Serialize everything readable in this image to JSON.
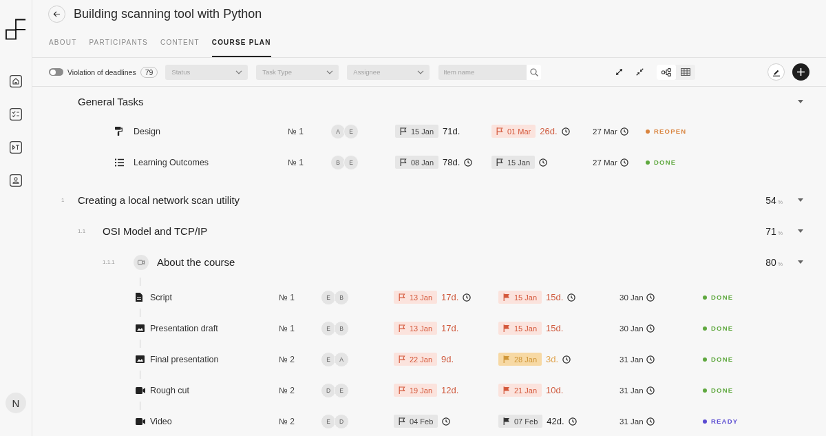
{
  "sidebar": {
    "user_initial": "N"
  },
  "header": {
    "title": "Building scanning tool with Python"
  },
  "tabs": [
    {
      "label": "ABOUT",
      "selected": false
    },
    {
      "label": "PARTICIPANTS",
      "selected": false
    },
    {
      "label": "CONTENT",
      "selected": false
    },
    {
      "label": "COURSE PLAN",
      "selected": true
    }
  ],
  "toolbar": {
    "deadline_filter": {
      "label": "Violation of deadlines",
      "on": false,
      "count": "79"
    },
    "filters": [
      {
        "placeholder": "Status"
      },
      {
        "placeholder": "Task Type"
      },
      {
        "placeholder": "Assignee"
      }
    ],
    "search": {
      "placeholder": "Item name"
    },
    "views": [
      {
        "kind": "tree",
        "selected": true
      },
      {
        "kind": "grid",
        "selected": false
      }
    ]
  },
  "plan": {
    "general": {
      "title": "General Tasks",
      "expanded": true,
      "tasks": [
        {
          "kind": "design",
          "name": "Design",
          "number": "№ 1",
          "assignees": [
            "A",
            "E"
          ],
          "start": {
            "date": "15 Jan",
            "overdue": false,
            "at_risk": false,
            "flag_filled": false,
            "days": "71d.",
            "timer": false
          },
          "due": {
            "date": "01 Mar",
            "overdue": true,
            "at_risk": false,
            "flag_filled": false,
            "days": "26d.",
            "timer": true
          },
          "end": {
            "date": "27 Mar"
          },
          "status": {
            "label": "REOPEN",
            "color": "#d9843f"
          }
        },
        {
          "kind": "outcomes",
          "name": "Learning Outcomes",
          "number": "№ 1",
          "assignees": [
            "B",
            "E"
          ],
          "start": {
            "date": "08 Jan",
            "overdue": false,
            "at_risk": false,
            "flag_filled": false,
            "days": "78d.",
            "timer": true
          },
          "due": {
            "date": "15 Jan",
            "overdue": false,
            "at_risk": false,
            "flag_filled": false,
            "timer": true
          },
          "end": {
            "date": "27 Mar"
          },
          "status": {
            "label": "DONE",
            "color": "#5fa83f"
          }
        }
      ]
    },
    "sections": [
      {
        "number": "1",
        "title": "Creating a local network scan utility",
        "progress": "54",
        "unit": "%",
        "expanded": true,
        "children": [
          {
            "number": "1.1",
            "title": "OSI Model and TCP/IP",
            "progress": "71",
            "unit": "%",
            "expanded": true,
            "children": [
              {
                "number": "1.1.1",
                "kind": "video",
                "title": "About the course",
                "progress": "80",
                "unit": "%",
                "expanded": true,
                "tasks": [
                  {
                    "kind": "script",
                    "name": "Script",
                    "number": "№ 1",
                    "assignees": [
                      "E",
                      "B"
                    ],
                    "start": {
                      "date": "13 Jan",
                      "overdue": true,
                      "at_risk": false,
                      "flag_filled": false,
                      "days": "17d.",
                      "timer": true
                    },
                    "due": {
                      "date": "15 Jan",
                      "overdue": true,
                      "at_risk": false,
                      "flag_filled": true,
                      "days": "15d.",
                      "timer": true
                    },
                    "end": {
                      "date": "30 Jan"
                    },
                    "status": {
                      "label": "DONE",
                      "color": "#5fa83f"
                    }
                  },
                  {
                    "kind": "image",
                    "name": "Presentation draft",
                    "number": "№ 1",
                    "assignees": [
                      "E",
                      "B"
                    ],
                    "start": {
                      "date": "13 Jan",
                      "overdue": true,
                      "at_risk": false,
                      "flag_filled": false,
                      "days": "17d.",
                      "timer": false
                    },
                    "due": {
                      "date": "15 Jan",
                      "overdue": true,
                      "at_risk": false,
                      "flag_filled": true,
                      "days": "15d.",
                      "timer": false
                    },
                    "end": {
                      "date": "30 Jan"
                    },
                    "status": {
                      "label": "DONE",
                      "color": "#5fa83f"
                    }
                  },
                  {
                    "kind": "image",
                    "name": "Final presentation",
                    "number": "№ 2",
                    "assignees": [
                      "E",
                      "A"
                    ],
                    "start": {
                      "date": "22 Jan",
                      "overdue": true,
                      "at_risk": false,
                      "flag_filled": false,
                      "days": "9d.",
                      "timer": false
                    },
                    "due": {
                      "date": "28 Jan",
                      "overdue": false,
                      "at_risk": true,
                      "flag_filled": true,
                      "days": "3d.",
                      "timer": true
                    },
                    "end": {
                      "date": "31 Jan"
                    },
                    "status": {
                      "label": "DONE",
                      "color": "#5fa83f"
                    }
                  },
                  {
                    "kind": "video",
                    "name": "Rough cut",
                    "number": "№ 2",
                    "assignees": [
                      "D",
                      "E"
                    ],
                    "start": {
                      "date": "19 Jan",
                      "overdue": true,
                      "at_risk": false,
                      "flag_filled": false,
                      "days": "12d.",
                      "timer": false
                    },
                    "due": {
                      "date": "21 Jan",
                      "overdue": true,
                      "at_risk": false,
                      "flag_filled": true,
                      "days": "10d.",
                      "timer": false
                    },
                    "end": {
                      "date": "31 Jan"
                    },
                    "status": {
                      "label": "DONE",
                      "color": "#5fa83f"
                    }
                  },
                  {
                    "kind": "video",
                    "name": "Video",
                    "number": "№ 2",
                    "assignees": [
                      "E",
                      "D"
                    ],
                    "start": {
                      "date": "04 Feb",
                      "overdue": false,
                      "at_risk": false,
                      "flag_filled": false,
                      "timer": true
                    },
                    "due": {
                      "date": "07 Feb",
                      "overdue": false,
                      "at_risk": false,
                      "flag_filled": true,
                      "days": "42d.",
                      "timer": true
                    },
                    "end": {
                      "date": "31 Jan"
                    },
                    "status": {
                      "label": "READY",
                      "color": "#5a4bd1"
                    }
                  }
                ]
              }
            ]
          }
        ]
      }
    ]
  }
}
